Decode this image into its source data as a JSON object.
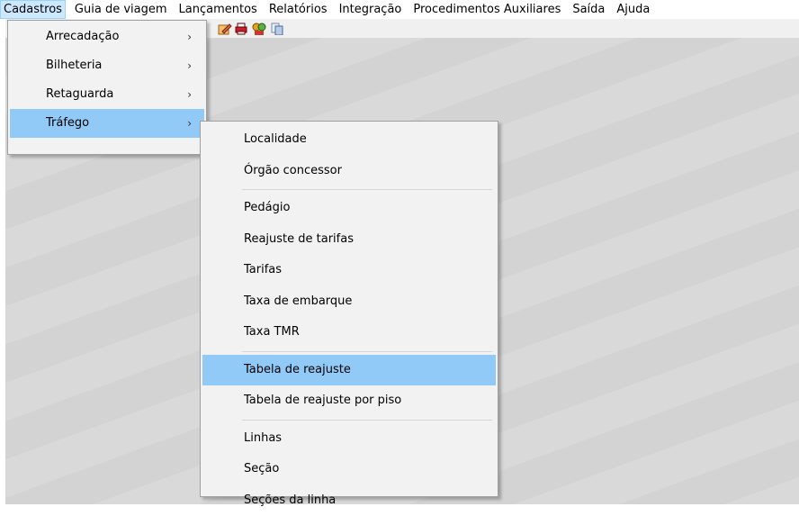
{
  "menubar": {
    "items": [
      {
        "label": "Cadastros"
      },
      {
        "label": "Guia de viagem"
      },
      {
        "label": "Lançamentos"
      },
      {
        "label": "Relatórios"
      },
      {
        "label": "Integração"
      },
      {
        "label": "Procedimentos Auxiliares"
      },
      {
        "label": "Saída"
      },
      {
        "label": "Ajuda"
      }
    ]
  },
  "toolbar": {
    "icons": [
      "edit-icon",
      "print-icon",
      "users-icon",
      "copy-icon"
    ]
  },
  "cadastros_menu": {
    "items": [
      {
        "label": "Arrecadação",
        "submenu_arrow": "›"
      },
      {
        "label": "Bilheteria",
        "submenu_arrow": "›"
      },
      {
        "label": "Retaguarda",
        "submenu_arrow": "›"
      },
      {
        "label": "Tráfego",
        "submenu_arrow": "›"
      }
    ]
  },
  "trafego_menu": {
    "group1": [
      {
        "label": "Localidade"
      },
      {
        "label": "Órgão concessor"
      }
    ],
    "group2": [
      {
        "label": "Pedágio"
      },
      {
        "label": "Reajuste de tarifas"
      },
      {
        "label": "Tarifas"
      },
      {
        "label": "Taxa de embarque"
      },
      {
        "label": "Taxa TMR"
      }
    ],
    "group3": [
      {
        "label": "Tabela de reajuste"
      },
      {
        "label": "Tabela de reajuste por piso"
      }
    ],
    "group4": [
      {
        "label": "Linhas"
      },
      {
        "label": "Seção"
      },
      {
        "label": "Seções da linha"
      }
    ]
  },
  "colors": {
    "highlight": "#91c9f7",
    "menubar_active": "#cce8ff"
  }
}
